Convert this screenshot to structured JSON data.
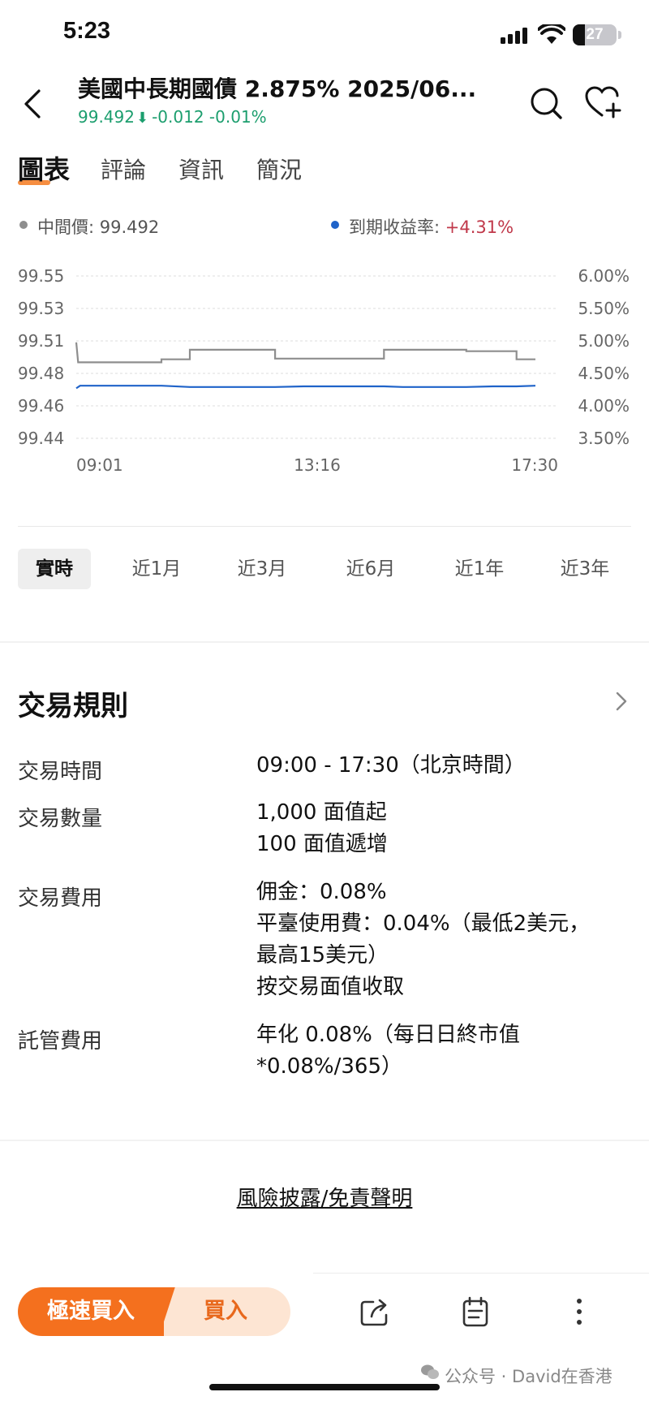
{
  "status_bar": {
    "time": "5:23",
    "battery": "27",
    "battery_level": 0.27
  },
  "header": {
    "title": "美國中長期國債 2.875% 2025/06...",
    "price": "99.492",
    "change": "-0.012",
    "change_pct": "-0.01%",
    "price_color": "#1c9e6e"
  },
  "tabs": [
    {
      "label": "圖表",
      "active": true
    },
    {
      "label": "評論"
    },
    {
      "label": "資訊"
    },
    {
      "label": "簡況"
    }
  ],
  "legend": {
    "mid_label": "中間價: ",
    "mid_value": "99.492",
    "ytm_label": "到期收益率: ",
    "ytm_value": "+4.31%",
    "mid_color": "#8e8e8e",
    "ytm_color": "#1f63c9"
  },
  "chart_data": {
    "type": "line",
    "y_left_ticks": [
      "99.55",
      "99.53",
      "99.51",
      "99.48",
      "99.46",
      "99.44"
    ],
    "y_right_ticks": [
      "6.00%",
      "5.50%",
      "5.00%",
      "4.50%",
      "4.00%",
      "3.50%"
    ],
    "x_ticks": [
      "09:01",
      "13:16",
      "17:30"
    ],
    "ylim_left": [
      99.44,
      99.55
    ],
    "ylim_right": [
      3.5,
      6.0
    ],
    "xlim": [
      0,
      509
    ],
    "grid": true,
    "series": [
      {
        "axis": "left",
        "color": "#8e8e8e",
        "points": [
          [
            0,
            99.505
          ],
          [
            2,
            99.4915
          ],
          [
            90,
            99.4915
          ],
          [
            90,
            99.4935
          ],
          [
            120,
            99.4935
          ],
          [
            120,
            99.5
          ],
          [
            210,
            99.5
          ],
          [
            210,
            99.494
          ],
          [
            325,
            99.494
          ],
          [
            325,
            99.5
          ],
          [
            412,
            99.5
          ],
          [
            412,
            99.499
          ],
          [
            465,
            99.499
          ],
          [
            465,
            99.4935
          ],
          [
            485,
            99.4935
          ]
        ]
      },
      {
        "axis": "right",
        "color": "#1f63c9",
        "points": [
          [
            0,
            4.27
          ],
          [
            4,
            4.31
          ],
          [
            90,
            4.31
          ],
          [
            120,
            4.29
          ],
          [
            210,
            4.29
          ],
          [
            240,
            4.3
          ],
          [
            325,
            4.3
          ],
          [
            345,
            4.29
          ],
          [
            412,
            4.29
          ],
          [
            440,
            4.3
          ],
          [
            465,
            4.3
          ],
          [
            485,
            4.31
          ]
        ]
      }
    ]
  },
  "ranges": [
    {
      "label": "實時",
      "active": true
    },
    {
      "label": "近1月"
    },
    {
      "label": "近3月"
    },
    {
      "label": "近6月"
    },
    {
      "label": "近1年"
    },
    {
      "label": "近3年"
    }
  ],
  "rules": {
    "title": "交易規則",
    "rows": [
      {
        "label": "交易時間",
        "lines": [
          "09:00 - 17:30（北京時間）"
        ]
      },
      {
        "label": "交易數量",
        "lines": [
          "1,000 面值起",
          "100 面值遞增"
        ]
      },
      {
        "label": "交易費用",
        "lines": [
          "佣金：0.08%",
          "平臺使用費：0.04%（最低2美元，",
          "最高15美元）",
          "按交易面值收取"
        ]
      },
      {
        "label": "託管費用",
        "lines": [
          "年化 0.08%（每日日終市值",
          "*0.08%/365）"
        ]
      }
    ]
  },
  "disclaimer": "風險披露/免責聲明",
  "bottom_bar": {
    "fast_buy": "極速買入",
    "buy": "買入",
    "accent": "#f4701e"
  },
  "watermark": "公众号 · David在香港"
}
